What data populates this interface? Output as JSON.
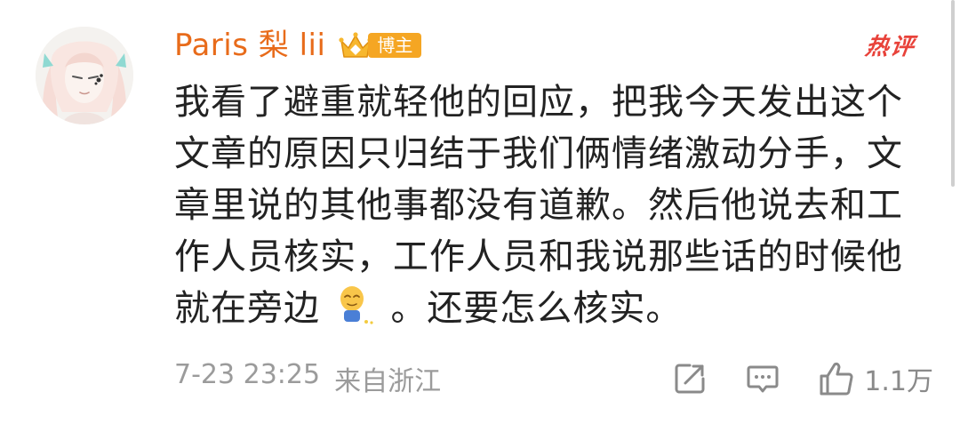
{
  "user": {
    "name": "Paris 梨 lii",
    "badge_label": "博主",
    "avatar_icon": "anime-girl-avatar"
  },
  "hot_tag": "热评",
  "comment": {
    "text_before_emoji": "我看了避重就轻他的回应，把我今天发出这个文章的原因只归结于我们俩情绪激动分手，文章里说的其他事都没有道歉。然后他说去和工作人员核实，工作人员和我说那些话的时候他就在旁边",
    "emoji_icon": "pee-emoji",
    "text_after_emoji": "。还要怎么核实。"
  },
  "meta": {
    "timestamp": "7-23 23:25",
    "location": "来自浙江"
  },
  "actions": {
    "share_icon": "share-icon",
    "reply_icon": "comment-icon",
    "like_icon": "thumbs-up-icon",
    "like_count": "1.1万"
  },
  "colors": {
    "username": "#e86b1a",
    "hot_tag": "#e8423a",
    "badge": "#f5a623",
    "body_text": "#222222",
    "meta_text": "#9b9b9b"
  }
}
